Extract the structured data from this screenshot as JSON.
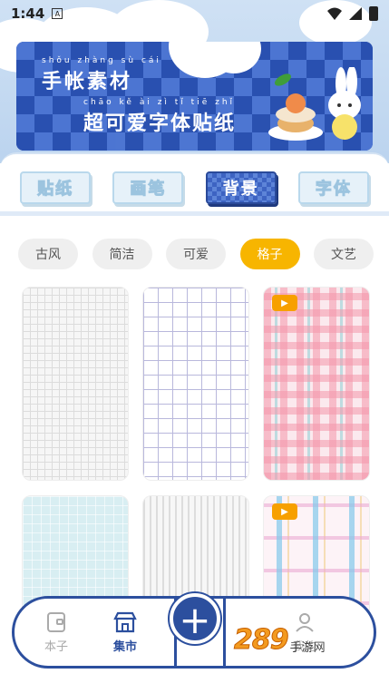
{
  "status_bar": {
    "time": "1:44",
    "a_badge": "A"
  },
  "banner": {
    "line1_pinyin": "shǒu zhàng sù cái",
    "line1": "手帐素材",
    "line2_pinyin": "chāo kě ài zì tǐ tiē zhǐ",
    "line2": "超可爱字体贴纸"
  },
  "category_tabs": [
    {
      "label": "贴纸",
      "active": false
    },
    {
      "label": "画笔",
      "active": false
    },
    {
      "label": "背景",
      "active": true
    },
    {
      "label": "字体",
      "active": false
    }
  ],
  "style_chips": [
    {
      "label": "古风",
      "active": false
    },
    {
      "label": "简洁",
      "active": false
    },
    {
      "label": "可爱",
      "active": false
    },
    {
      "label": "格子",
      "active": true
    },
    {
      "label": "文艺",
      "active": false
    }
  ],
  "tiles": [
    {
      "pattern": "gray-grid",
      "video": false
    },
    {
      "pattern": "blue-grid",
      "video": false
    },
    {
      "pattern": "pink-plaid",
      "video": true
    },
    {
      "pattern": "cyan-grid",
      "video": false
    },
    {
      "pattern": "gray-stripes",
      "video": false
    },
    {
      "pattern": "pastel-plaid",
      "video": true
    }
  ],
  "bottom_nav": {
    "notebook_label": "本子",
    "market_label": "集市",
    "plus_symbol": "+",
    "fourth_label": "我的"
  },
  "watermark": {
    "number": "289",
    "suffix": "手游网"
  },
  "colors": {
    "accent": "#2c4f9e",
    "chip_active": "#f7b500",
    "video_badge": "#f7a000"
  }
}
